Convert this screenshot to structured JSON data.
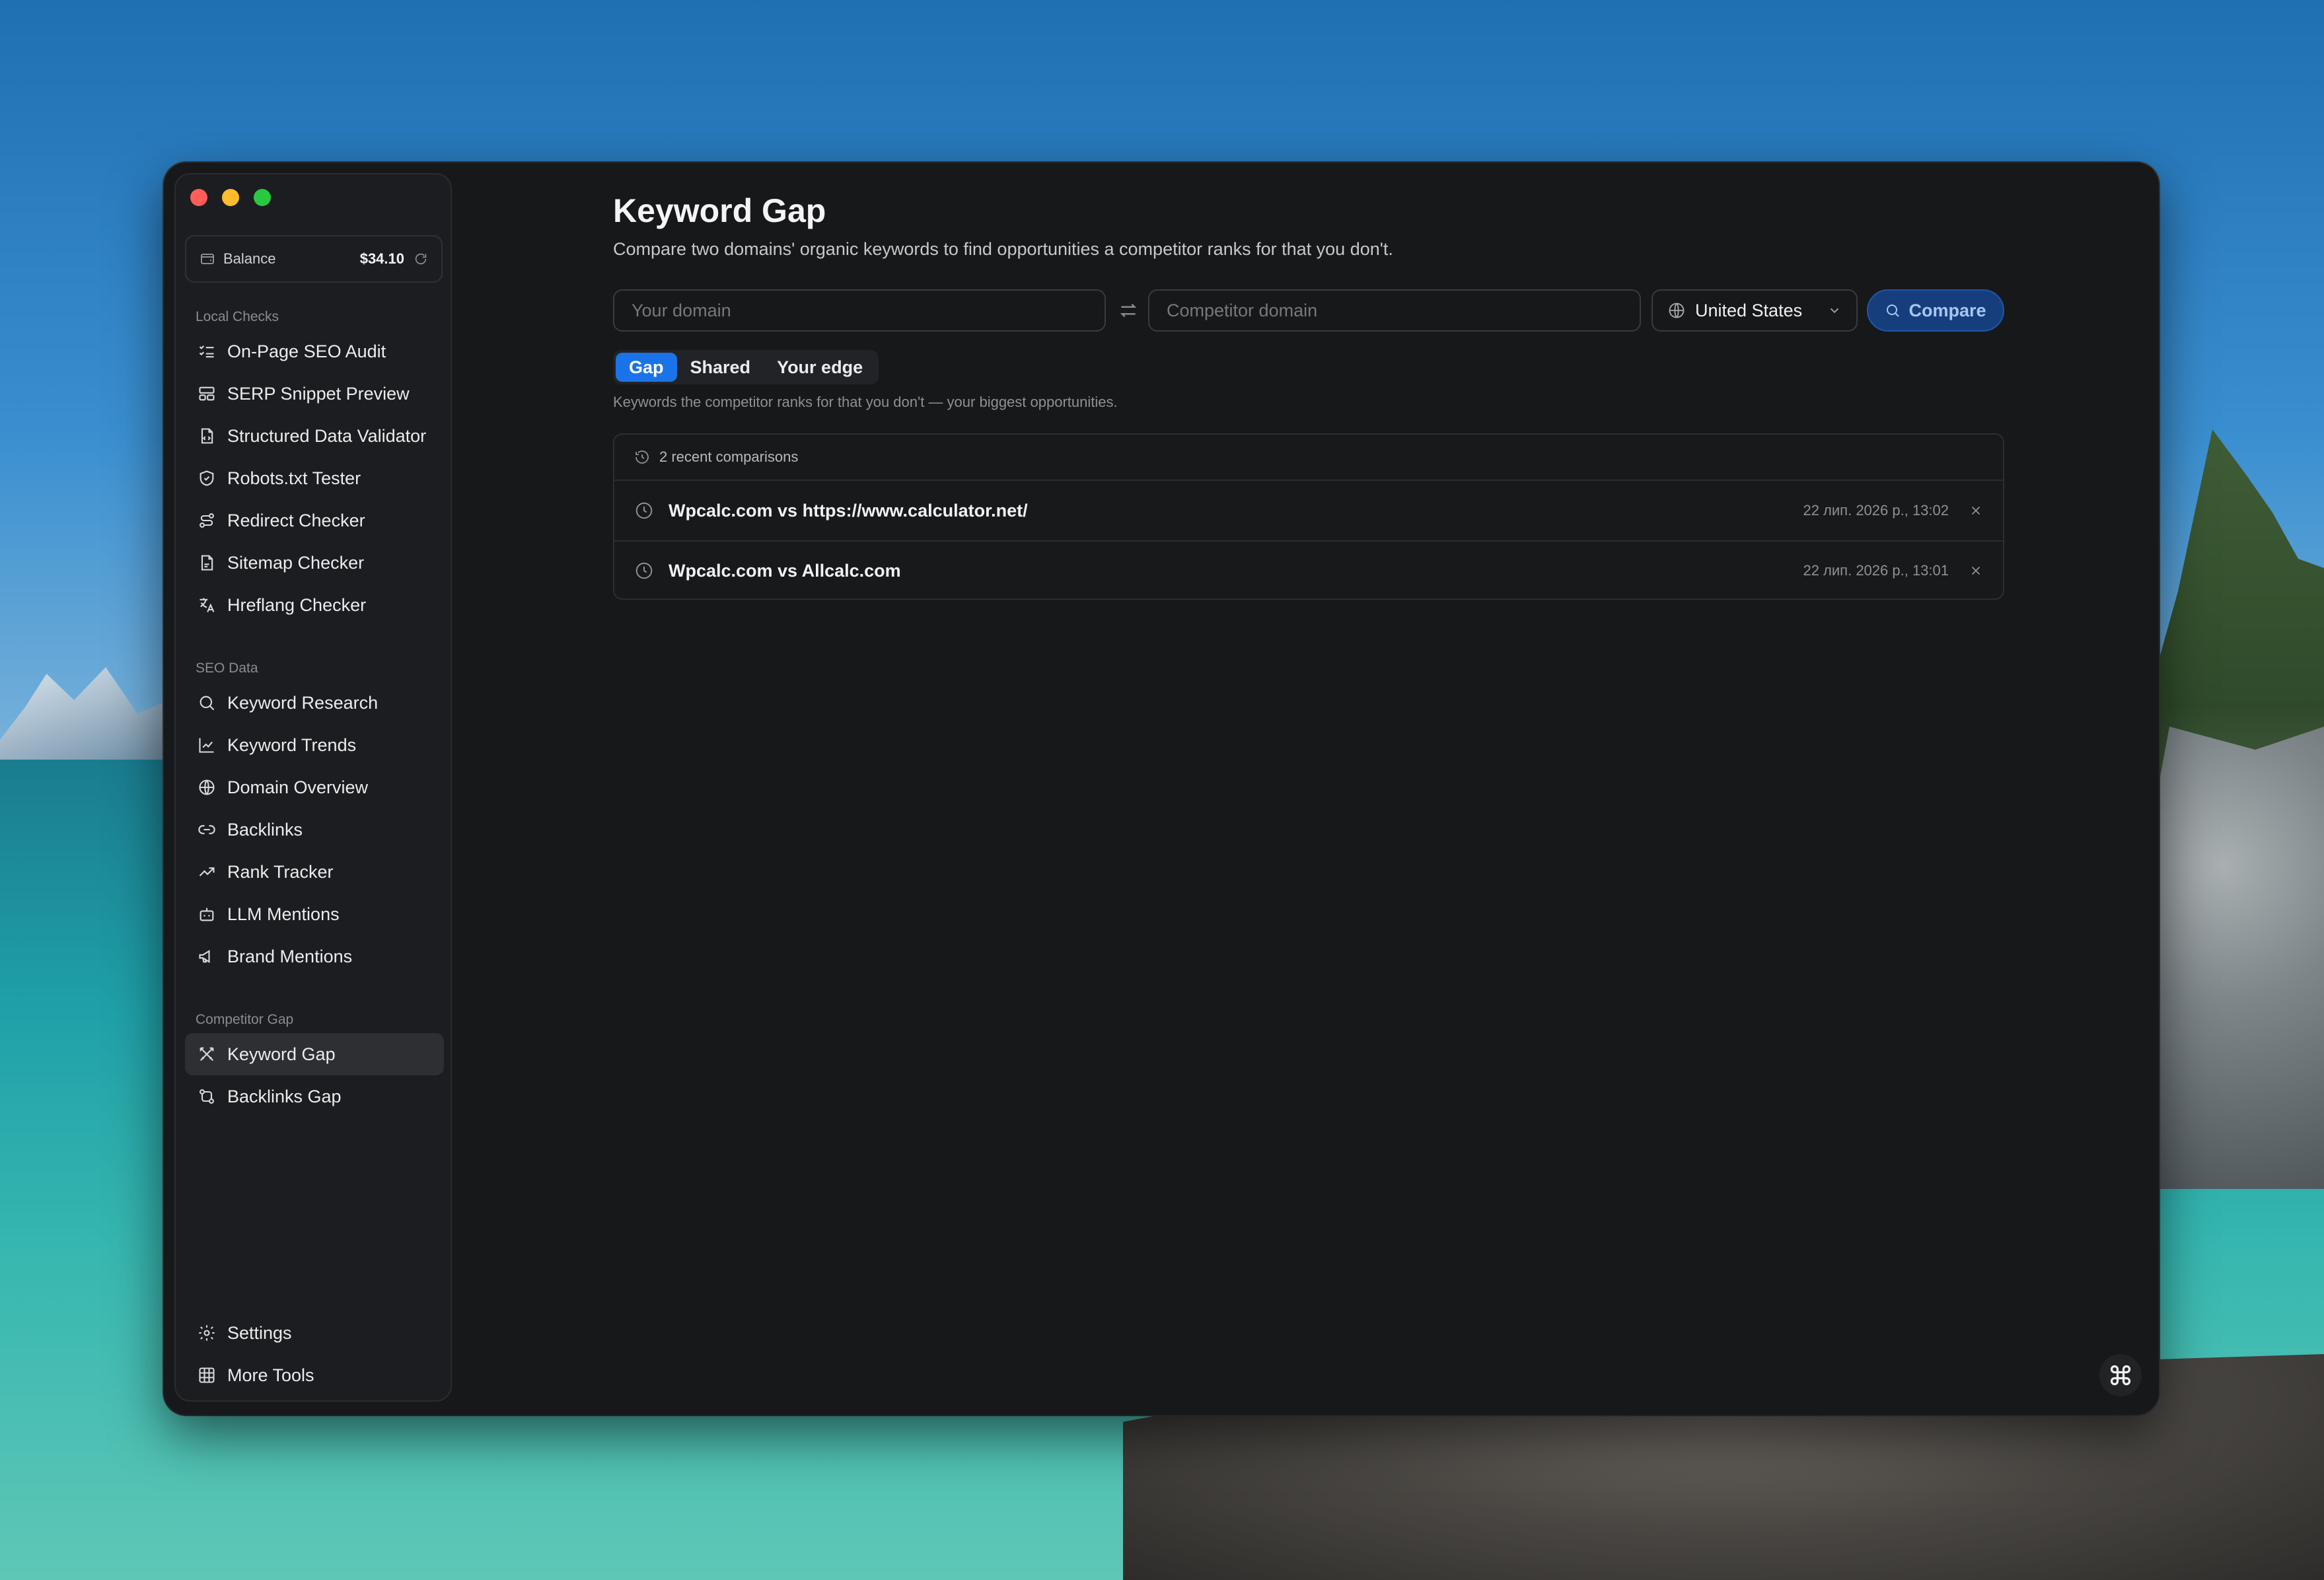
{
  "sidebar": {
    "balance": {
      "label": "Balance",
      "value": "$34.10"
    },
    "sections": [
      {
        "title": "Local Checks",
        "items": [
          {
            "label": "On-Page SEO Audit",
            "icon": "checklist-icon"
          },
          {
            "label": "SERP Snippet Preview",
            "icon": "layout-icon"
          },
          {
            "label": "Structured Data Validator",
            "icon": "file-code-icon"
          },
          {
            "label": "Robots.txt Tester",
            "icon": "shield-check-icon"
          },
          {
            "label": "Redirect Checker",
            "icon": "route-icon"
          },
          {
            "label": "Sitemap Checker",
            "icon": "file-map-icon"
          },
          {
            "label": "Hreflang Checker",
            "icon": "translate-icon"
          }
        ]
      },
      {
        "title": "SEO Data",
        "items": [
          {
            "label": "Keyword Research",
            "icon": "search-icon"
          },
          {
            "label": "Keyword Trends",
            "icon": "line-chart-icon"
          },
          {
            "label": "Domain Overview",
            "icon": "globe-icon"
          },
          {
            "label": "Backlinks",
            "icon": "link-icon"
          },
          {
            "label": "Rank Tracker",
            "icon": "trending-up-icon"
          },
          {
            "label": "LLM Mentions",
            "icon": "bot-icon"
          },
          {
            "label": "Brand Mentions",
            "icon": "megaphone-icon"
          }
        ]
      },
      {
        "title": "Competitor Gap",
        "items": [
          {
            "label": "Keyword Gap",
            "icon": "swords-icon",
            "active": true
          },
          {
            "label": "Backlinks Gap",
            "icon": "git-compare-icon"
          }
        ]
      }
    ],
    "footer": [
      {
        "label": "Settings",
        "icon": "gear-icon"
      },
      {
        "label": "More Tools",
        "icon": "grid-icon"
      }
    ]
  },
  "main": {
    "title": "Keyword Gap",
    "subtitle": "Compare two domains' organic keywords to find opportunities a competitor ranks for that you don't.",
    "your_domain": {
      "value": "",
      "placeholder": "Your domain"
    },
    "competitor_domain": {
      "value": "",
      "placeholder": "Competitor domain"
    },
    "country": "United States",
    "compare_label": "Compare",
    "tabs": [
      {
        "label": "Gap",
        "active": true
      },
      {
        "label": "Shared"
      },
      {
        "label": "Your edge"
      }
    ],
    "tab_description": "Keywords the competitor ranks for that you don't — your biggest opportunities.",
    "recent": {
      "header": "2 recent comparisons",
      "items": [
        {
          "title": "Wpcalc.com vs https://www.calculator.net/",
          "time": "22 лип. 2026 р., 13:02"
        },
        {
          "title": "Wpcalc.com vs Allcalc.com",
          "time": "22 лип. 2026 р., 13:01"
        }
      ]
    }
  },
  "colors": {
    "accent": "#1a73e8",
    "compare_bg": "#173e7c",
    "window_bg": "#17181a",
    "sidebar_bg": "#1c1d20"
  }
}
